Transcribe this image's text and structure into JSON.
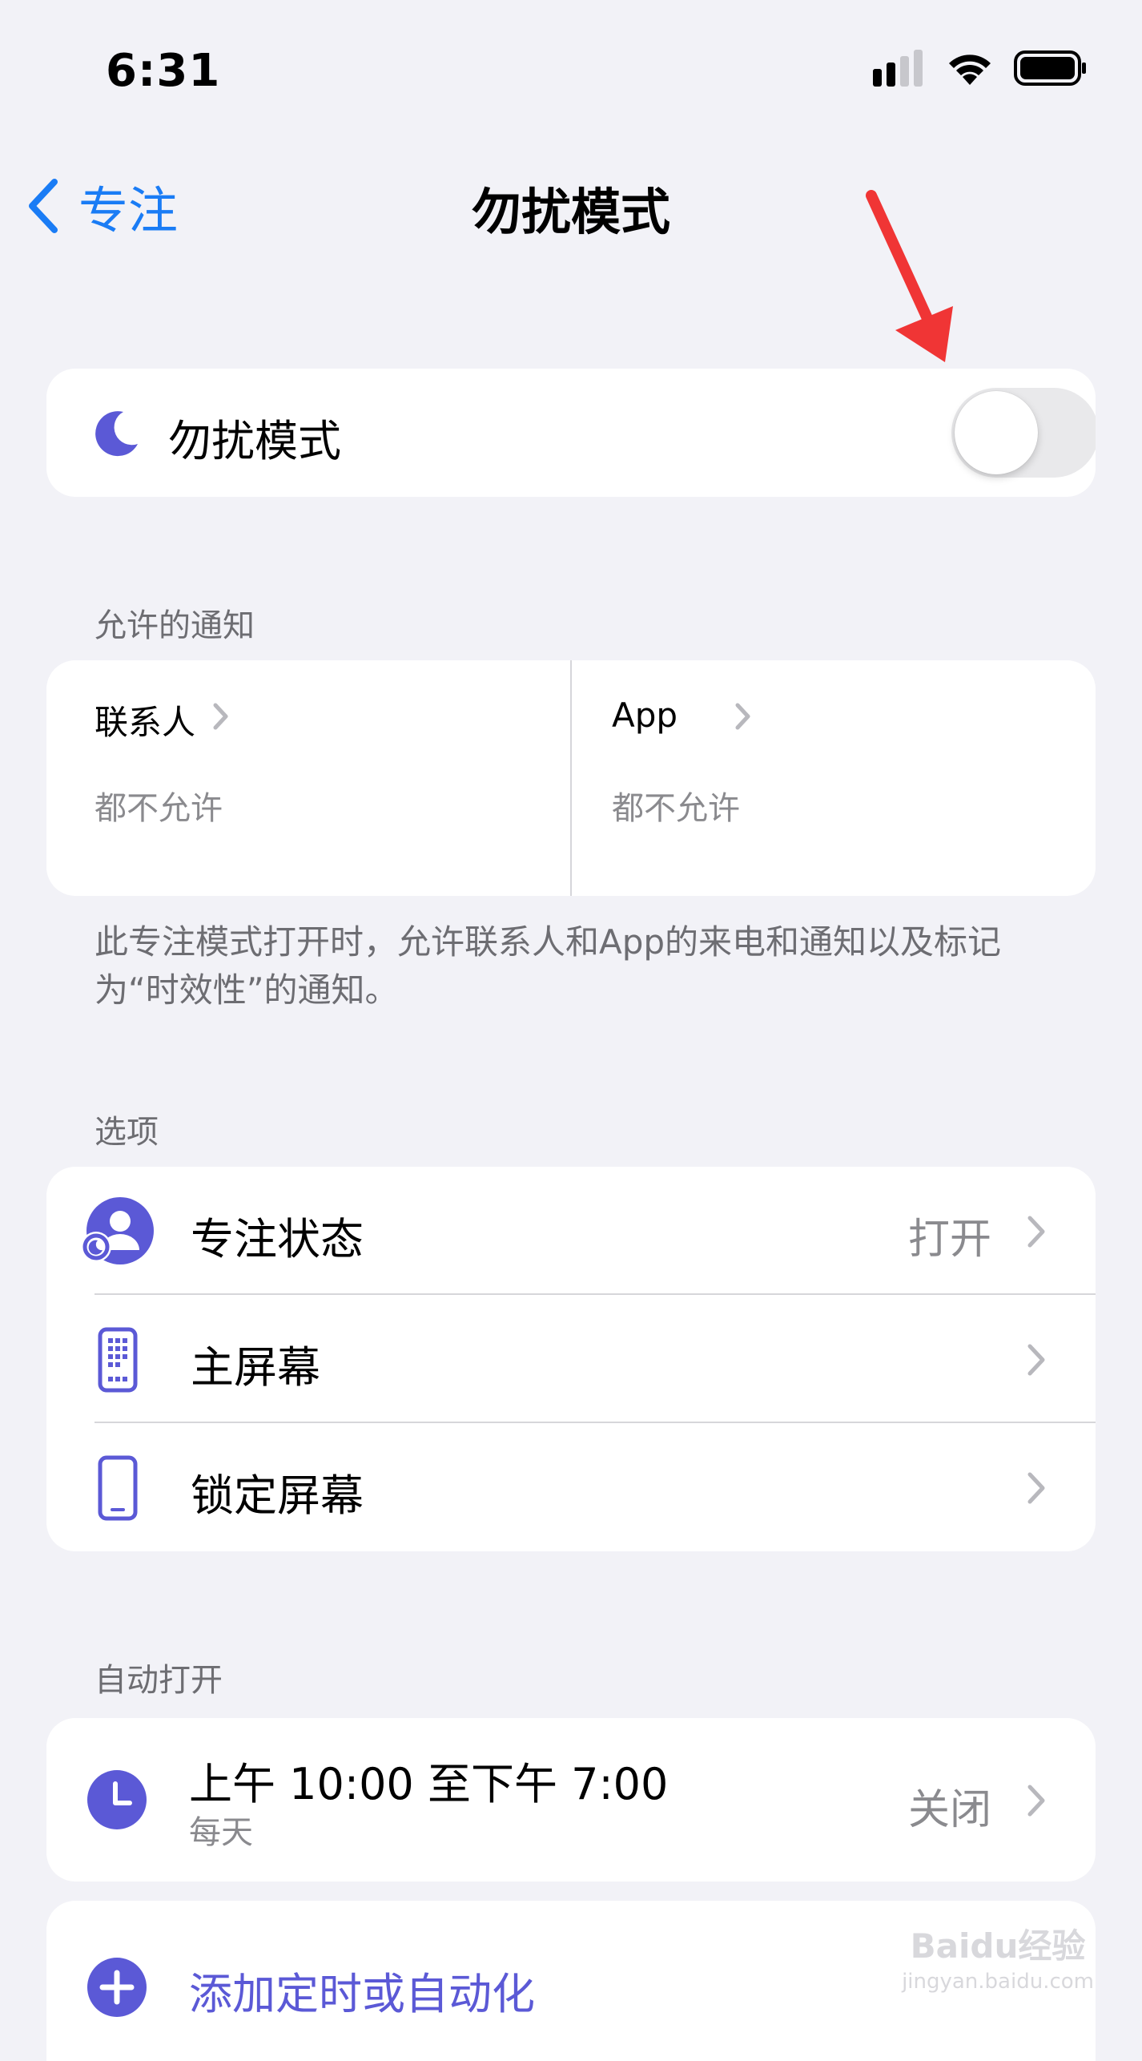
{
  "status_bar": {
    "time": "6:31"
  },
  "nav": {
    "back_label": "专注",
    "title": "勿扰模式"
  },
  "focus_toggle": {
    "label": "勿扰模式",
    "on": false
  },
  "allowed": {
    "section_label": "允许的通知",
    "people": {
      "title": "联系人",
      "value": "都不允许"
    },
    "apps": {
      "title": "App",
      "value": "都不允许"
    },
    "note": "此专注模式打开时，允许联系人和App的来电和通知以及标记为“时效性”的通知。"
  },
  "options": {
    "section_label": "选项",
    "items": [
      {
        "label": "专注状态",
        "value": "打开"
      },
      {
        "label": "主屏幕",
        "value": ""
      },
      {
        "label": "锁定屏幕",
        "value": ""
      }
    ]
  },
  "auto": {
    "section_label": "自动打开",
    "schedule": {
      "title": "上午 10:00 至下午 7:00",
      "subtitle": "每天",
      "value": "关闭"
    },
    "add_label": "添加定时或自动化"
  },
  "watermark": {
    "brand": "Baidu经验",
    "url": "jingyan.baidu.com"
  },
  "colors": {
    "accent_blue": "#1a7cf5",
    "focus_purple": "#5b59d6",
    "annotation_red": "#f03535",
    "background": "#f2f2f7"
  }
}
